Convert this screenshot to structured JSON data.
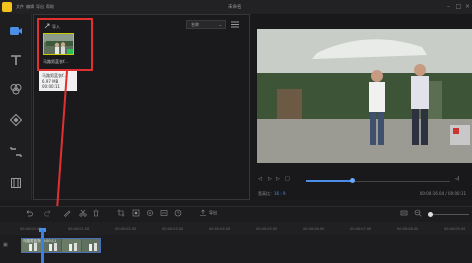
{
  "titlebar": {
    "title": "未命名",
    "menus": [
      "文件",
      "编辑",
      "导出",
      "帮助"
    ]
  },
  "media": {
    "import_label": "导入",
    "sort_value": "名称",
    "file_name": "马路男蓝衣f...",
    "tooltip": {
      "lines": [
        "马路男蓝衣f...",
        "6.97 MB",
        "00:00:11"
      ]
    }
  },
  "preview": {
    "ratio_label": "宽高比：",
    "ratio_value": "16 : 9",
    "timecode": "00:00:16.04 / 00:00:11"
  },
  "toolbar": {
    "export_label": "导出"
  },
  "ruler": {
    "ticks": [
      "00:00:00.00",
      "00:00:01.00",
      "00:00:02.00",
      "00:00:03.00",
      "00:00:04.00",
      "00:00:05.00",
      "00:00:06.00",
      "00:00:07.00",
      "00:00:08.00",
      "00:00:09.00",
      "00:00:10.00"
    ]
  },
  "timeline": {
    "clip_label": "马路男蓝衣00:00:11"
  },
  "colors": {
    "accent": "#4a8ee6",
    "highlight_box": "#e03030",
    "logo": "#f4c21a"
  }
}
